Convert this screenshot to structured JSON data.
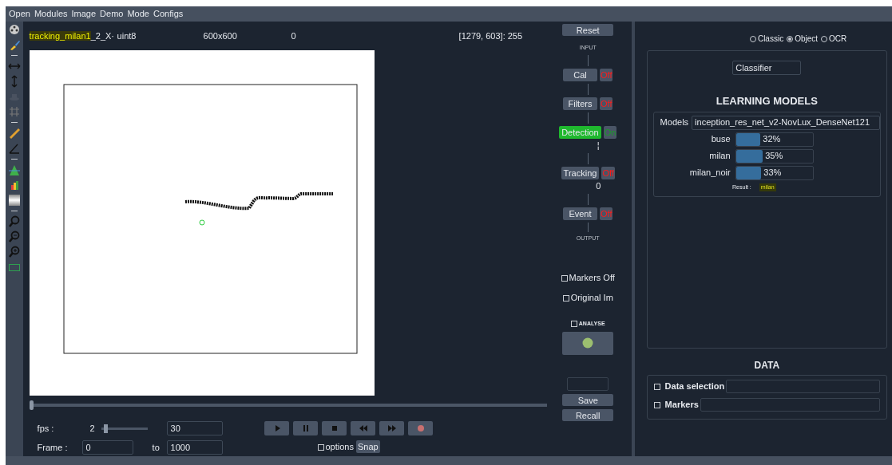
{
  "menu": [
    "Open",
    "Modules",
    "Image",
    "Demo",
    "Mode",
    "Configs"
  ],
  "image_info": {
    "filename_highlight": "tracking_milan1",
    "filename_rest": "_2_X·",
    "dtype": "uint8",
    "size": "600x600",
    "value": "0",
    "pixel": "[1279, 603]: 255"
  },
  "timeline": {
    "level": 0
  },
  "playback": {
    "fps_label": "fps :",
    "fps_value": "2",
    "fps_slider": {
      "level": 0.07
    },
    "fps_max": "30",
    "frame_label": "Frame :",
    "frame_from": "0",
    "to_label": "to",
    "frame_to": "1000",
    "buttons": [
      {
        "kind": "play"
      },
      {
        "kind": "pause"
      },
      {
        "kind": "stop"
      },
      {
        "kind": "rewind"
      },
      {
        "kind": "forward"
      },
      {
        "kind": "record"
      }
    ],
    "options": {
      "label": "options",
      "checked": false
    },
    "snap": "Snap"
  },
  "pipeline": {
    "reset": "Reset",
    "input_label": "INPUT",
    "output_label": "OUTPUT",
    "modules": [
      {
        "label": "Cal",
        "state": "Off",
        "on": false
      },
      {
        "label": "Filters",
        "state": "Off",
        "on": false
      },
      {
        "label": "Detection",
        "state": "On",
        "on": true,
        "indicator": "¦"
      },
      {
        "label": "Tracking",
        "state": "Off",
        "on": false,
        "indicator": "0"
      },
      {
        "label": "Event",
        "state": "Off",
        "on": false
      }
    ]
  },
  "side_checks": [
    {
      "label": "Markers Off",
      "checked": false
    },
    {
      "label": "Original Im",
      "checked": false
    }
  ],
  "analyse": {
    "label": "ANALYSE",
    "checked": false
  },
  "save": "Save",
  "recall": "Recall",
  "modes": [
    {
      "label": "Classic",
      "selected": false
    },
    {
      "label": "Object",
      "selected": true
    },
    {
      "label": "OCR",
      "selected": false
    }
  ],
  "method": "Classifier",
  "learning": {
    "title": "LEARNING MODELS",
    "models_label": "Models",
    "model": "inception_res_net_v2-NovLux_DenseNet121",
    "classes": [
      {
        "name": "buse",
        "level": 0.32,
        "reading": "32%"
      },
      {
        "name": "milan",
        "level": 0.35,
        "reading": "35%"
      },
      {
        "name": "milan_noir",
        "level": 0.33,
        "reading": "33%"
      }
    ],
    "result_label": "Result :",
    "result": "milan"
  },
  "data": {
    "title": "DATA",
    "sections": [
      {
        "label": "Data selection",
        "checked": false
      },
      {
        "label": "Markers",
        "checked": false
      }
    ]
  }
}
